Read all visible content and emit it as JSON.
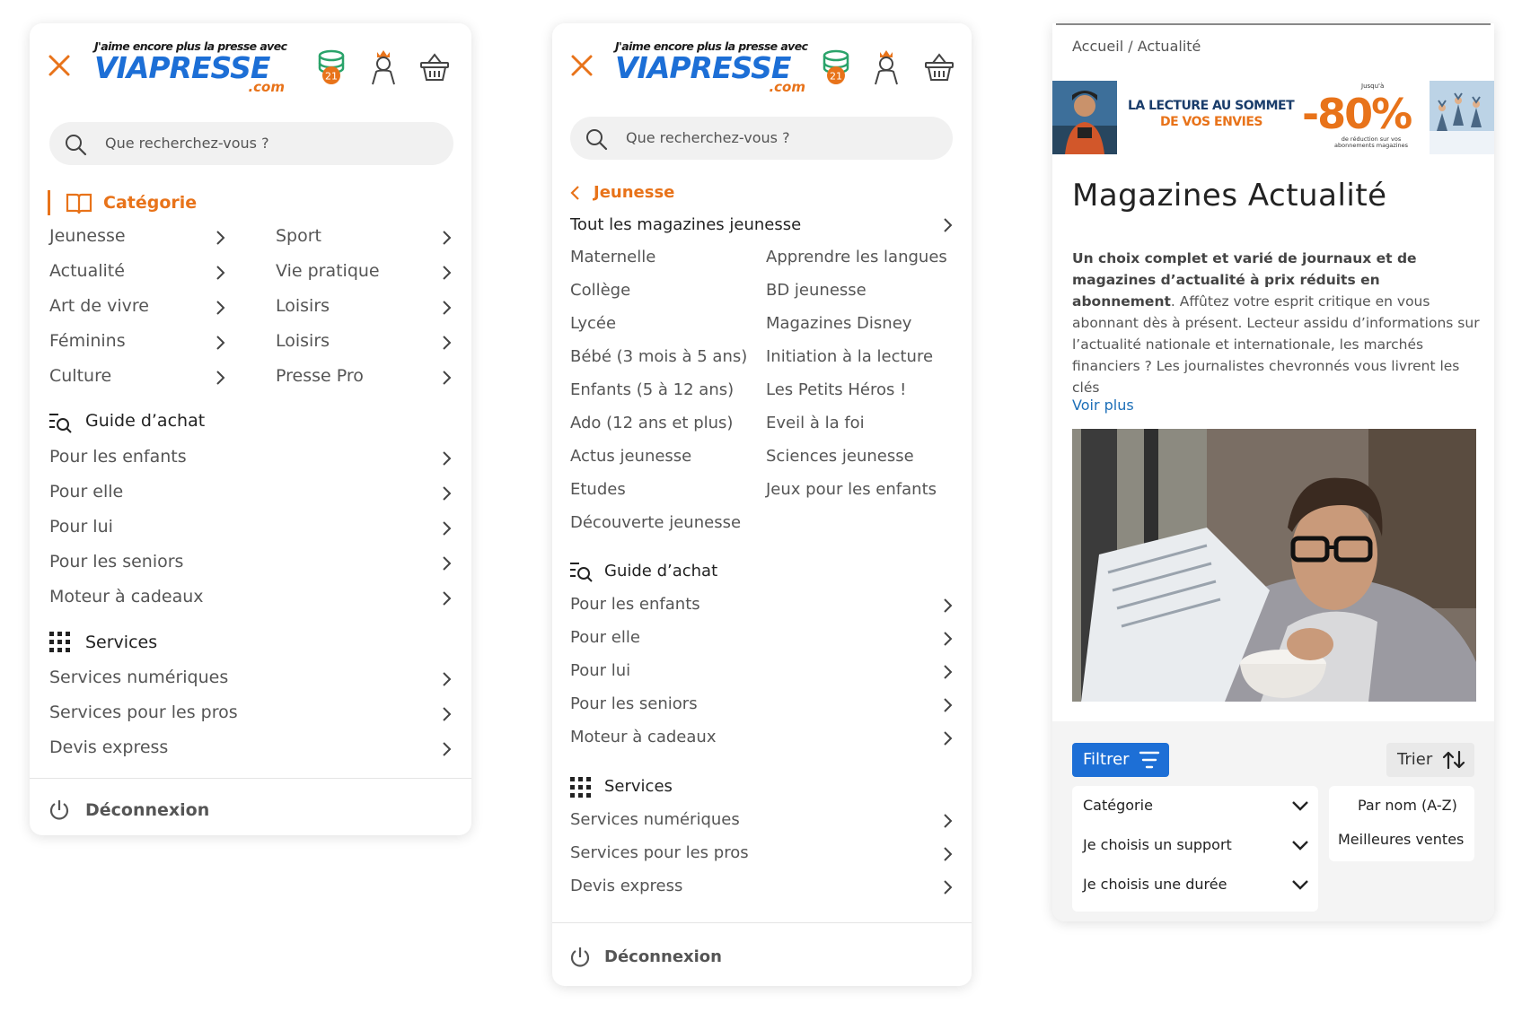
{
  "header": {
    "tagline": "J'aime encore plus la presse avec",
    "brand": "VIAPRESSE",
    "brand_suffix": ".com",
    "coins_badge": "21",
    "search_placeholder": "Que recherchez-vous ?"
  },
  "colors": {
    "accent": "#e8731a",
    "brand_blue": "#1d6fd6",
    "link": "#1d6fb8"
  },
  "panel1": {
    "category_title": "Catégorie",
    "categories_left": [
      "Jeunesse",
      "Actualité",
      "Art de vivre",
      "Féminins",
      "Culture"
    ],
    "categories_right": [
      "Sport",
      "Vie pratique",
      "Loisirs",
      "Loisirs",
      "Presse Pro"
    ],
    "guide_title": "Guide d’achat",
    "guide_items": [
      "Pour les enfants",
      "Pour elle",
      "Pour lui",
      "Pour les seniors",
      "Moteur à cadeaux"
    ],
    "services_title": "Services",
    "services_items": [
      "Services numériques",
      "Services pour les pros",
      "Devis express"
    ],
    "logout": "Déconnexion"
  },
  "panel2": {
    "back_title": "Jeunesse",
    "all_label": "Tout les magazines jeunesse",
    "sub_left": [
      "Maternelle",
      "Collège",
      "Lycée",
      "Bébé (3 mois à 5 ans)",
      "Enfants (5 à 12 ans)",
      "Ado (12 ans et plus)",
      "Actus jeunesse",
      "Etudes",
      "Découverte jeunesse"
    ],
    "sub_right": [
      "Apprendre les langues",
      "BD jeunesse",
      "Magazines Disney",
      "Initiation à la lecture",
      "Les Petits Héros !",
      "Eveil à la foi",
      "Sciences jeunesse",
      "Jeux pour les enfants"
    ],
    "guide_title": "Guide d’achat",
    "guide_items": [
      "Pour les enfants",
      "Pour elle",
      "Pour lui",
      "Pour les seniors",
      "Moteur à cadeaux"
    ],
    "services_title": "Services",
    "services_items": [
      "Services numériques",
      "Services pour les pros",
      "Devis express"
    ],
    "logout": "Déconnexion"
  },
  "panel3": {
    "breadcrumb": "Accueil / Actualité",
    "banner": {
      "line1": "LA LECTURE AU SOMMET",
      "line2": "DE VOS ENVIES",
      "upto": "Jusqu'à",
      "percent": "-80%",
      "sub": "de réduction sur vos abonnements magazines"
    },
    "title": "Magazines Actualité",
    "desc_bold": "Un choix complet et varié de journaux et de magazines d’actualité à prix réduits en abonnement",
    "desc_rest": ". Affûtez votre esprit critique en vous abonnant dès à présent. Lecteur assidu d’informations sur l’actualité nationale et internationale, les marchés financiers ? Les journalistes chevronnés vous livrent les clés",
    "voir_plus": "Voir plus",
    "filter_label": "Filtrer",
    "sort_label": "Trier",
    "dropdowns": [
      "Catégorie",
      "Je choisis un support",
      "Je choisis une durée"
    ],
    "sort_options": [
      "Par nom (A-Z)",
      "Meilleures ventes"
    ]
  }
}
